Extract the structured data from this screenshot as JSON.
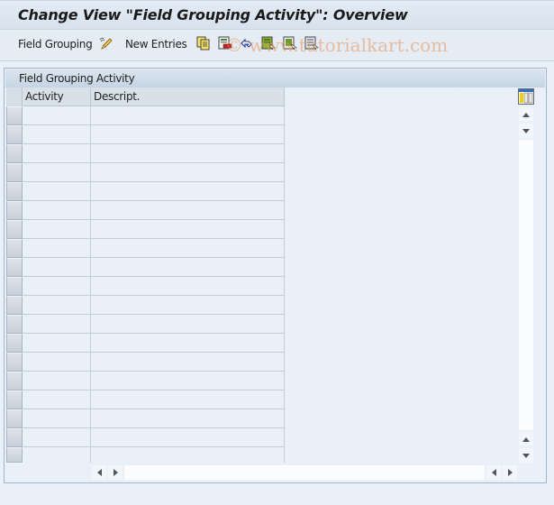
{
  "window": {
    "title": "Change View \"Field Grouping Activity\": Overview"
  },
  "toolbar": {
    "field_grouping_label": "Field Grouping",
    "new_entries_label": "New Entries",
    "icons": [
      "display-change-icon",
      "copy-icon",
      "delete-icon",
      "undo-change-icon",
      "select-all-icon",
      "select-block-icon",
      "deselect-all-icon"
    ]
  },
  "watermark": "© www.tutorialkart.com",
  "panel": {
    "title": "Field Grouping Activity",
    "columns": [
      {
        "label": "Activity"
      },
      {
        "label": "Descript."
      }
    ],
    "rows": [
      {
        "activity": "",
        "description": ""
      },
      {
        "activity": "",
        "description": ""
      },
      {
        "activity": "",
        "description": ""
      },
      {
        "activity": "",
        "description": ""
      },
      {
        "activity": "",
        "description": ""
      },
      {
        "activity": "",
        "description": ""
      },
      {
        "activity": "",
        "description": ""
      },
      {
        "activity": "",
        "description": ""
      },
      {
        "activity": "",
        "description": ""
      },
      {
        "activity": "",
        "description": ""
      },
      {
        "activity": "",
        "description": ""
      },
      {
        "activity": "",
        "description": ""
      },
      {
        "activity": "",
        "description": ""
      },
      {
        "activity": "",
        "description": ""
      },
      {
        "activity": "",
        "description": ""
      },
      {
        "activity": "",
        "description": ""
      },
      {
        "activity": "",
        "description": ""
      },
      {
        "activity": "",
        "description": ""
      },
      {
        "activity": "",
        "description": ""
      }
    ]
  }
}
